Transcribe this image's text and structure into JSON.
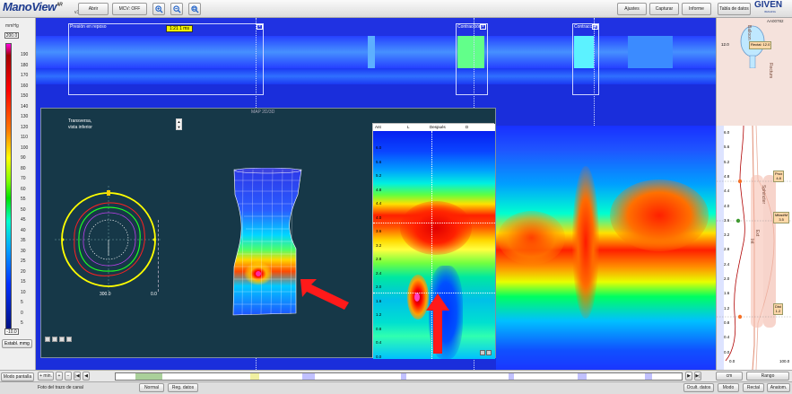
{
  "app": {
    "name": "ManoView",
    "name_sup": "AR",
    "version": "v3.0",
    "brand": "GIVEN",
    "brand_sub": "IMAGING",
    "study_code": "AA00782"
  },
  "toolbar": {
    "abrir": "Abrir",
    "mcv": "MCV: OFF",
    "ajustes": "Ajustes",
    "capturar": "Capturar",
    "informe": "Informe",
    "tabla": "Tabla de datos"
  },
  "scale": {
    "unit": "mmHg",
    "max": "200.0",
    "min": "-10.0",
    "ticks": [
      "190",
      "180",
      "170",
      "160",
      "150",
      "140",
      "130",
      "120",
      "110",
      "100",
      "90",
      "80",
      "70",
      "60",
      "55",
      "50",
      "45",
      "40",
      "35",
      "30",
      "25",
      "20",
      "15",
      "10",
      "5",
      "0",
      "5"
    ],
    "establish_button": "Establ. mmg"
  },
  "trace": {
    "segments": [
      {
        "label": "Presión en reposo"
      },
      {
        "label": "Contracción"
      },
      {
        "label": "Contracción"
      }
    ],
    "time_marker": "1:21  1 ms"
  },
  "overlay": {
    "title": "MAP 2D/3D",
    "view_label_1": "Transversa,",
    "view_label_2": "vista inferior",
    "circle_left": "300.0",
    "circle_right": "0.0",
    "heat": {
      "header": [
        "Ant",
        "L",
        "Después",
        "D"
      ],
      "y_ticks": [
        "6.0",
        "5.6",
        "5.2",
        "4.8",
        "4.4",
        "4.0",
        "3.6",
        "3.2",
        "2.8",
        "2.4",
        "2.0",
        "1.6",
        "1.2",
        "0.8",
        "0.4",
        "0.0"
      ]
    }
  },
  "anatomy": {
    "balloon": "Balloon",
    "rectal": "Rectal: 12.0",
    "rectum": "Rectum",
    "sphincter": "Sphincter",
    "ext": "Ext",
    "int": "Int",
    "boxes": [
      {
        "label": "Prox",
        "value": "4.8"
      },
      {
        "label": "Mitad/M",
        "value": "3.5"
      },
      {
        "label": "Dist",
        "value": "1.2"
      }
    ],
    "y_ticks": [
      "6.0",
      "5.6",
      "5.2",
      "4.8",
      "4.4",
      "4.0",
      "3.6",
      "3.2",
      "2.8",
      "2.4",
      "2.0",
      "1.6",
      "1.2",
      "0.8",
      "0.4",
      "0.0"
    ],
    "x_left": "0.0",
    "x_right": "100.0",
    "top_value": "12.0"
  },
  "bottom": {
    "modo_pantalla": "Modo pantalla",
    "zoom_in": "+ min.",
    "cm_label": "cm",
    "rango": "Rango",
    "foto_label": "Foto del trazo de canal",
    "normal": "Normal",
    "reg_datos": "Reg. datos",
    "ocult_datos": "Ocult. datos",
    "modo": "Modo",
    "rectal": "Rectal",
    "anatom": "Anatom."
  },
  "colors": {
    "trace_bg": "#1a2edb",
    "overlay_bg": "#163848",
    "arrow": "#ff1a1a",
    "timebox": "#f4f400"
  }
}
